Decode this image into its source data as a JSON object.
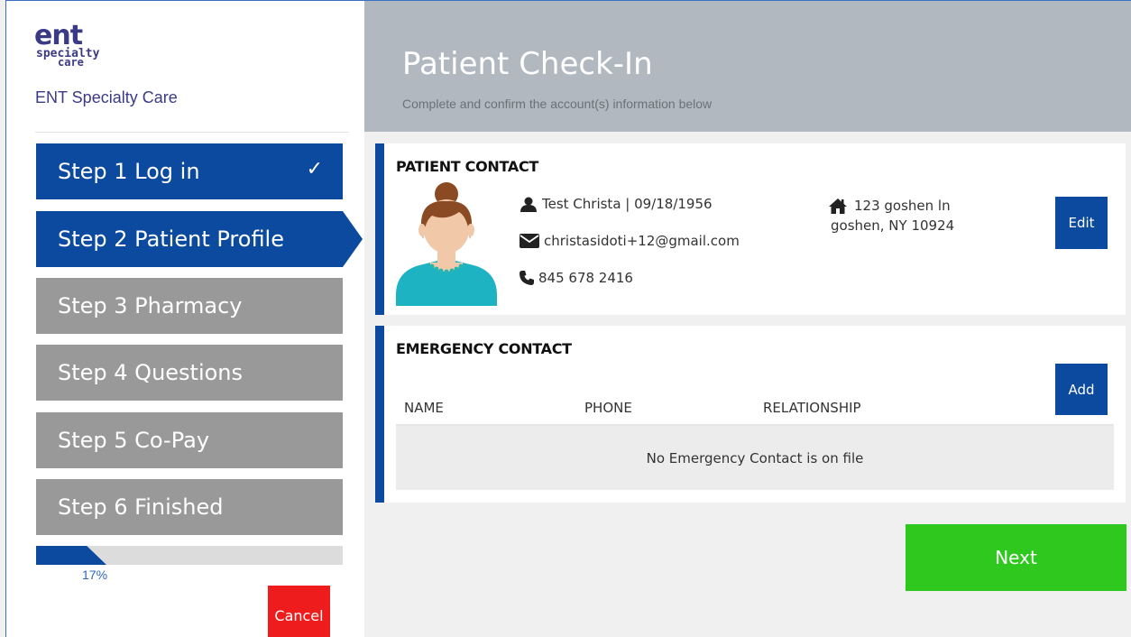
{
  "brand": {
    "logo_text": "ent specialty care",
    "name": "ENT Specialty Care",
    "color": "#3b3a86"
  },
  "steps": [
    {
      "label": "Step 1 Log in",
      "state": "done",
      "check": "✓"
    },
    {
      "label": "Step 2 Patient Profile",
      "state": "active"
    },
    {
      "label": "Step 3 Pharmacy",
      "state": "pending"
    },
    {
      "label": "Step 4 Questions",
      "state": "pending"
    },
    {
      "label": "Step 5 Co-Pay",
      "state": "pending"
    },
    {
      "label": "Step 6 Finished",
      "state": "pending"
    }
  ],
  "progress": {
    "percent": 17,
    "label": "17%"
  },
  "cancel_label": "Cancel",
  "header": {
    "title": "Patient Check-In",
    "subtitle": "Complete and confirm the account(s) information below"
  },
  "patient_contact": {
    "title": "PATIENT CONTACT",
    "name_dob": "Test Christa | 09/18/1956",
    "email": "christasidoti+12@gmail.com",
    "phone": "845 678 2416",
    "address_line1": "123 goshen ln",
    "address_line2": "goshen, NY 10924",
    "edit_label": "Edit"
  },
  "emergency_contact": {
    "title": "EMERGENCY CONTACT",
    "add_label": "Add",
    "columns": [
      "NAME",
      "PHONE",
      "RELATIONSHIP"
    ],
    "empty_message": "No Emergency Contact is on file"
  },
  "next_label": "Next",
  "colors": {
    "primary": "#0b4a9e",
    "pending": "#999999",
    "danger": "#ee1c1c",
    "success": "#2ec81e",
    "header_bg": "#b1b8bf"
  },
  "icons": [
    "user-icon",
    "envelope-icon",
    "phone-icon",
    "home-icon",
    "checkmark-icon"
  ]
}
